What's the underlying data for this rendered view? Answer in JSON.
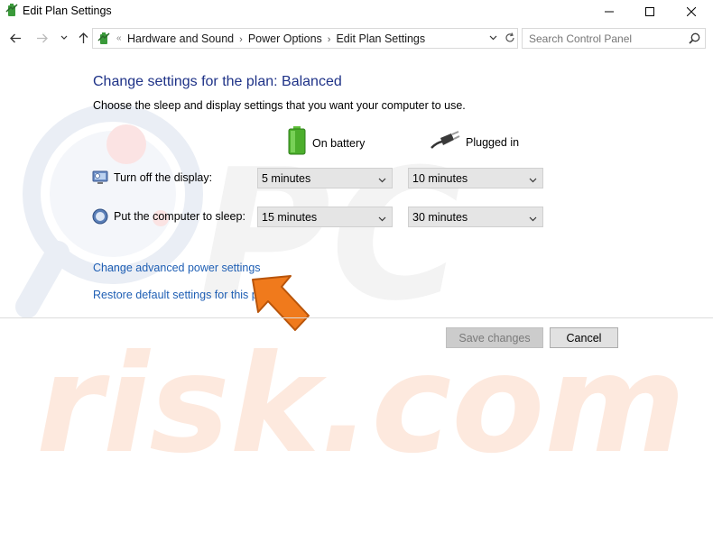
{
  "window": {
    "title": "Edit Plan Settings"
  },
  "address_bar": {
    "crumbs": [
      "Hardware and Sound",
      "Power Options",
      "Edit Plan Settings"
    ],
    "separator": "›"
  },
  "search": {
    "placeholder": "Search Control Panel"
  },
  "content": {
    "heading": "Change settings for the plan: Balanced",
    "subheading": "Choose the sleep and display settings that you want your computer to use.",
    "columns": {
      "on_battery": "On battery",
      "plugged_in": "Plugged in"
    },
    "rows": [
      {
        "label": "Turn off the display:",
        "icon": "display-icon",
        "on_battery": "5 minutes",
        "plugged_in": "10 minutes"
      },
      {
        "label": "Put the computer to sleep:",
        "icon": "sleep-icon",
        "on_battery": "15 minutes",
        "plugged_in": "30 minutes"
      }
    ],
    "links": {
      "advanced": "Change advanced power settings",
      "restore": "Restore default settings for this pl"
    }
  },
  "buttons": {
    "save": "Save changes",
    "cancel": "Cancel"
  },
  "colors": {
    "heading": "#1e3287",
    "link": "#1f5fb4",
    "arrow": "#f07a1c",
    "watermark": "#e8eef6"
  }
}
